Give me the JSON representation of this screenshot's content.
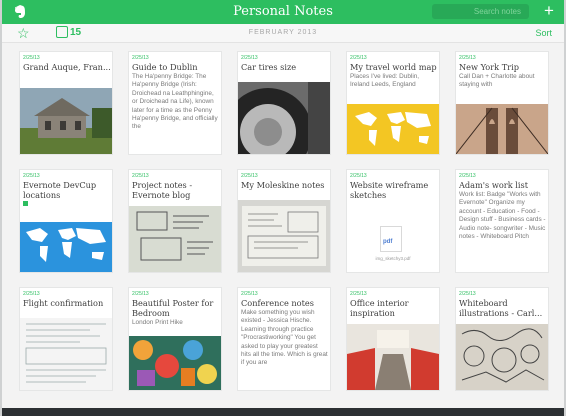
{
  "app": {
    "title": "Personal Notes",
    "search_placeholder": "Search notes"
  },
  "toolbar": {
    "reminder_count": "15",
    "month": "FEBRUARY 2013",
    "sort_label": "Sort"
  },
  "notes": [
    {
      "date": "2/25/13",
      "title": "Grand Auque, Fran...",
      "body": "",
      "image": "house-photo"
    },
    {
      "date": "2/25/13",
      "title": "Guide to Dublin",
      "body": "The Ha'penny Bridge: The Ha'penny Bridge (Irish: Droichead na Leathphingine, or Droichead na Life), known later for a time as the Penny Ha'penny Bridge, and officially the",
      "image": ""
    },
    {
      "date": "2/25/13",
      "title": "Car tires size",
      "body": "",
      "image": "tire-photo"
    },
    {
      "date": "2/25/13",
      "title": "My travel world map",
      "body": "Places I've lived: Dublin, Ireland Leeds, England",
      "image": "world-map-yellow"
    },
    {
      "date": "2/25/13",
      "title": "New York Trip",
      "body": "Call Dan + Charlotte about staying with",
      "image": "bridge-photo"
    },
    {
      "date": "2/25/13",
      "title": "Evernote DevCup locations",
      "body": "",
      "image": "world-map-blue"
    },
    {
      "date": "2/25/13",
      "title": "Project notes - Evernote blog",
      "body": "",
      "image": "whiteboard-sketch"
    },
    {
      "date": "2/25/13",
      "title": "My Moleskine notes",
      "body": "",
      "image": "moleskine-sketch"
    },
    {
      "date": "2/25/13",
      "title": "Website wireframe sketches",
      "body": "",
      "image": "pdf-attachment",
      "file": "img_sketchy3.pdf",
      "file_type": "pdf"
    },
    {
      "date": "2/25/13",
      "title": "Adam's work list",
      "body": "Work list: Badge \"Works with Evernote\" Organize my account - Education - Food - Design stuff - Business cards - Audio note- songwriter - Music notes - Whiteboard Pitch",
      "image": ""
    },
    {
      "date": "2/25/13",
      "title": "Flight confirmation",
      "body": "",
      "image": "document-scan"
    },
    {
      "date": "2/25/13",
      "title": "Beautiful Poster for Bedroom",
      "body": "London Print Hike",
      "image": "poster-colorful"
    },
    {
      "date": "2/25/13",
      "title": "Conference notes",
      "body": "Make something you wish existed - Jessica Hische. Learning through practice \"Procrastiworking\" You get asked to play your greatest hits all the time. Which is great if you are",
      "image": ""
    },
    {
      "date": "2/25/13",
      "title": "Office interior inspiration",
      "body": "",
      "image": "office-photo"
    },
    {
      "date": "2/25/13",
      "title": "Whiteboard illustrations - Carl...",
      "body": "",
      "image": "doodle-sketch"
    }
  ],
  "colors": {
    "accent": "#2dbe60",
    "titlebar": "#2dbe60"
  }
}
